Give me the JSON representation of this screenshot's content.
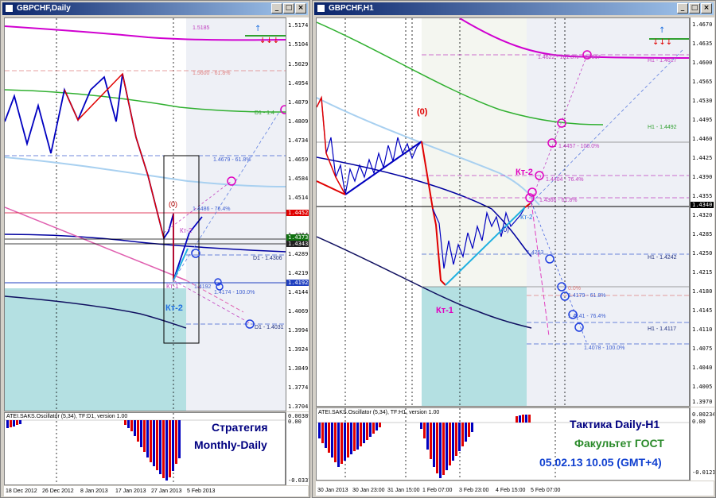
{
  "left": {
    "title": "GBPCHF,Daily",
    "prices": [
      "1.5174",
      "1.5104",
      "1.5029",
      "1.4954",
      "1.4879",
      "1.4809",
      "1.4734",
      "1.4659",
      "1.4584",
      "1.4514",
      "1.4439",
      "1.4364",
      "1.4289",
      "1.4219",
      "1.4144",
      "1.4069",
      "1.3994",
      "1.3924",
      "1.3849",
      "1.3774",
      "1.3704"
    ],
    "tags": {
      "red": "1.4452",
      "green": "1.4373",
      "dark": "1.4343",
      "blue": "1.4192"
    },
    "levels": [
      "1.5185",
      "1.5600 - 61.8%",
      "1.4679 - 61.8%",
      "1.4486 - 76.4%",
      "1.4486",
      "D1 - 1.4306",
      "1.4192",
      "1.4174 - 100.0%",
      "D1 - 1.4031",
      "D1 - 1.4"
    ],
    "labels": {
      "zero": "(0)",
      "kt2a": "Кт-2",
      "kt1": "Кт-1",
      "kt2b": "Кт-2"
    },
    "osc_title": "ATEI.SAKS.Oscillator (5,34), TF:D1, version 1.00",
    "osc_max": "0.00389",
    "osc_zero": "0.00",
    "osc_min": "-0.03373",
    "strategy_line1": "Стратегия",
    "strategy_line2": "Monthly-Daily",
    "dates": [
      "18 Dec 2012",
      "26 Dec 2012",
      "8 Jan 2013",
      "17 Jan 2013",
      "27 Jan 2013",
      "5 Feb 2013"
    ]
  },
  "right": {
    "title": "GBPCHF,H1",
    "prices": [
      "1.4670",
      "1.4635",
      "1.4600",
      "1.4565",
      "1.4530",
      "1.4495",
      "1.4460",
      "1.4425",
      "1.4390",
      "1.4355",
      "1.4320",
      "1.4285",
      "1.4250",
      "1.4215",
      "1.4180",
      "1.4145",
      "1.4110",
      "1.4075",
      "1.4040",
      "1.4005",
      "1.3970"
    ],
    "tags": {
      "black": "1.4340"
    },
    "levels": [
      "1.4622 - 161.8% - 1.4617",
      "H1 - 1.4617",
      "H1 - 1.4492",
      "1.4457 - 100.0%",
      "1.4404 - 76.4%",
      "1.4366 - 61.8%",
      "H1 - 1.4242",
      "1.4253",
      "1.4179 - 61.8%",
      "1.4141 - 76.4%",
      "H1 - 1.4117",
      "1.4078 - 100.0%",
      "0.0%"
    ],
    "labels": {
      "zero": "(0)",
      "zero2": "(0)",
      "kt2": "Кт-2",
      "kt2s": "Кт-2",
      "kt1": "Кт-1"
    },
    "osc_title": "ATEI.SAKS.Oscillator (5,34), TF:H1, version 1.00",
    "osc_max": "0.00234",
    "osc_zero": "0.00",
    "osc_min": "-0.01215",
    "tactic": "Тактика Daily-H1",
    "faculty": "Факультет ГОСТ",
    "datetime": "05.02.13   10.05 (GMT+4)",
    "dates": [
      "30 Jan 2013",
      "30 Jan 23:00",
      "31 Jan 15:00",
      "1 Feb 07:00",
      "3 Feb 23:00",
      "4 Feb 15:00",
      "5 Feb 07:00"
    ]
  },
  "colors": {
    "accent_blue": "#0a246a",
    "price_red": "#e00000",
    "price_blue": "#0000c0",
    "kt_magenta": "#e000e0",
    "faculty_green": "#2a8a2a"
  }
}
